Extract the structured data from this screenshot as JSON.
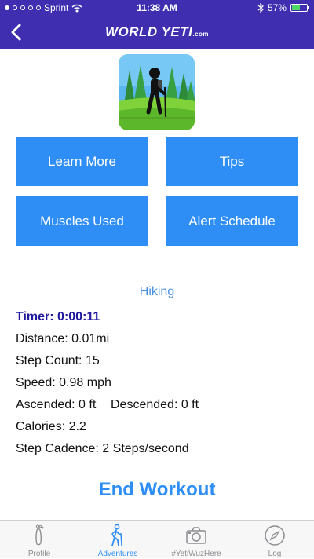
{
  "status_bar": {
    "carrier": "Sprint",
    "time": "11:38 AM",
    "battery": "57%",
    "battery_level": 0.57
  },
  "header": {
    "logo_text": "WORLD YETI",
    "logo_suffix": ".com"
  },
  "buttons": {
    "learn_more": "Learn More",
    "tips": "Tips",
    "muscles_used": "Muscles Used",
    "alert_schedule": "Alert Schedule"
  },
  "activity": {
    "title": "Hiking"
  },
  "stats": {
    "timer": "Timer: 0:00:11",
    "distance": "Distance: 0.01mi",
    "step_count": "Step Count: 15",
    "speed": "Speed: 0.98 mph",
    "ascended": "Ascended: 0 ft",
    "descended": "Descended: 0 ft",
    "calories": "Calories: 2.2",
    "step_cadence": "Step Cadence: 2 Steps/second"
  },
  "end_workout_label": "End Workout",
  "tabs": [
    {
      "label": "Profile",
      "icon": "footprint-icon"
    },
    {
      "label": "Adventures",
      "icon": "hiker-icon"
    },
    {
      "label": "#YetiWuzHere",
      "icon": "camera-icon"
    },
    {
      "label": "Log",
      "icon": "compass-icon"
    }
  ],
  "colors": {
    "header_bg": "#3f2fb0",
    "button_bg": "#2e8ef5",
    "timer": "#1f1a9e",
    "activity_title": "#4a90e2"
  }
}
